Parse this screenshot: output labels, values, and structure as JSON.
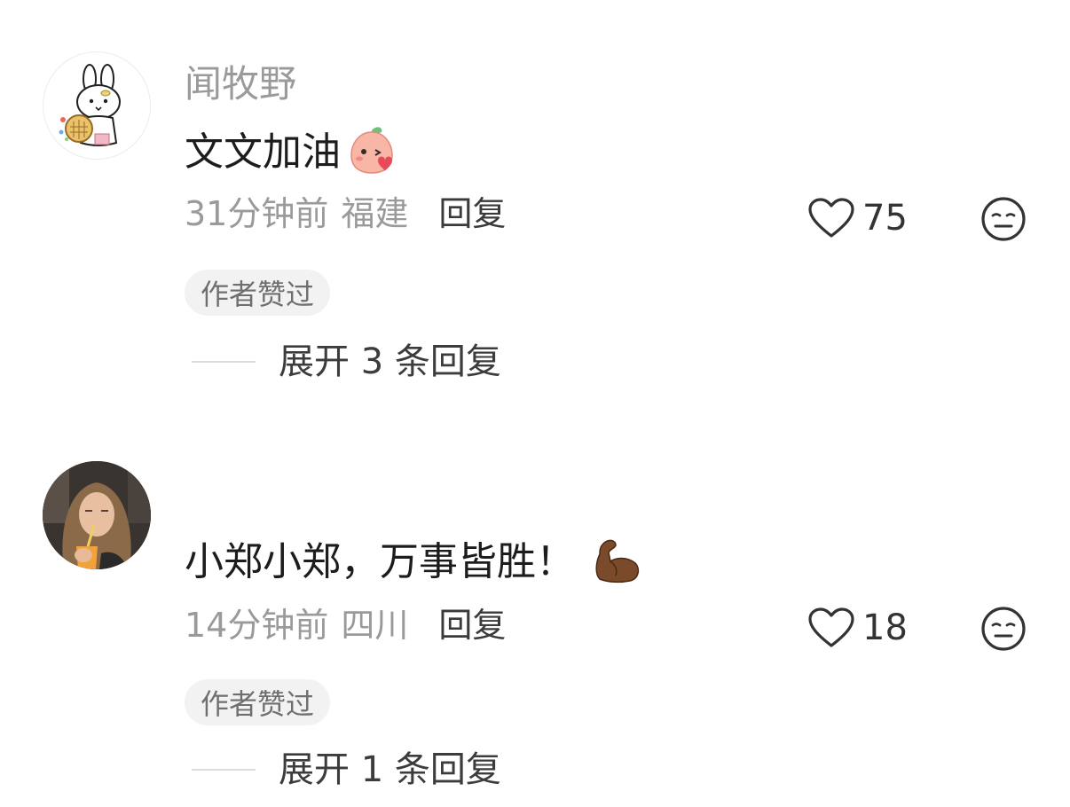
{
  "comments": [
    {
      "username": "闻牧野",
      "text": "文文加油",
      "sticker": "peach-kiss-sticker",
      "time": "31分钟前",
      "region": "福建",
      "reply_label": "回复",
      "likes": "75",
      "badge": "作者赞过",
      "expand_label": "展开 3 条回复",
      "avatar": "bunny-avatar"
    },
    {
      "username": "",
      "text": "小郑小郑，万事皆胜！",
      "sticker": "flexed-biceps-emoji",
      "time": "14分钟前",
      "region": "四川",
      "reply_label": "回复",
      "likes": "18",
      "badge": "作者赞过",
      "expand_label": "展开 1 条回复",
      "avatar": "photo-avatar"
    }
  ],
  "colors": {
    "muted_text": "#9a9a9a",
    "main_text": "#1c1c1c",
    "badge_bg": "#f2f2f2",
    "icon_stroke": "#333333"
  }
}
